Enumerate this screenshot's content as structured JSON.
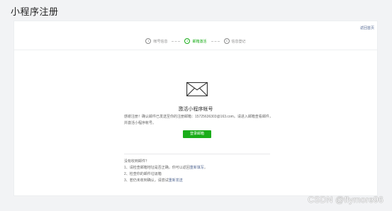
{
  "page": {
    "title": "小程序注册"
  },
  "card": {
    "back_link": "返回首页",
    "steps": [
      {
        "num": "1",
        "label": "帐号信息"
      },
      {
        "num": "2",
        "label": "邮箱激活"
      },
      {
        "num": "3",
        "label": "信息登记"
      }
    ],
    "activate_title": "激活小程序帐号",
    "notice": "感谢注册！确认邮件已发送至你的注册邮箱：15725636303@163.com。请进入邮箱查看邮件，并激活小程序帐号。",
    "login_button": "登录邮箱",
    "help": {
      "heading": "没有收到邮件？",
      "line1_prefix": "1、请检查邮箱地址是否正确，你可以返回",
      "line1_link": "重新填写",
      "line1_suffix": "。",
      "line2": "2、检查你的邮件垃圾箱",
      "line3_prefix": "3、若仍未收到确认，请尝试",
      "line3_link": "重新发送"
    }
  },
  "watermark": "CSDN @flymore96",
  "colors": {
    "accent": "#1aad19",
    "link": "#576b95"
  }
}
